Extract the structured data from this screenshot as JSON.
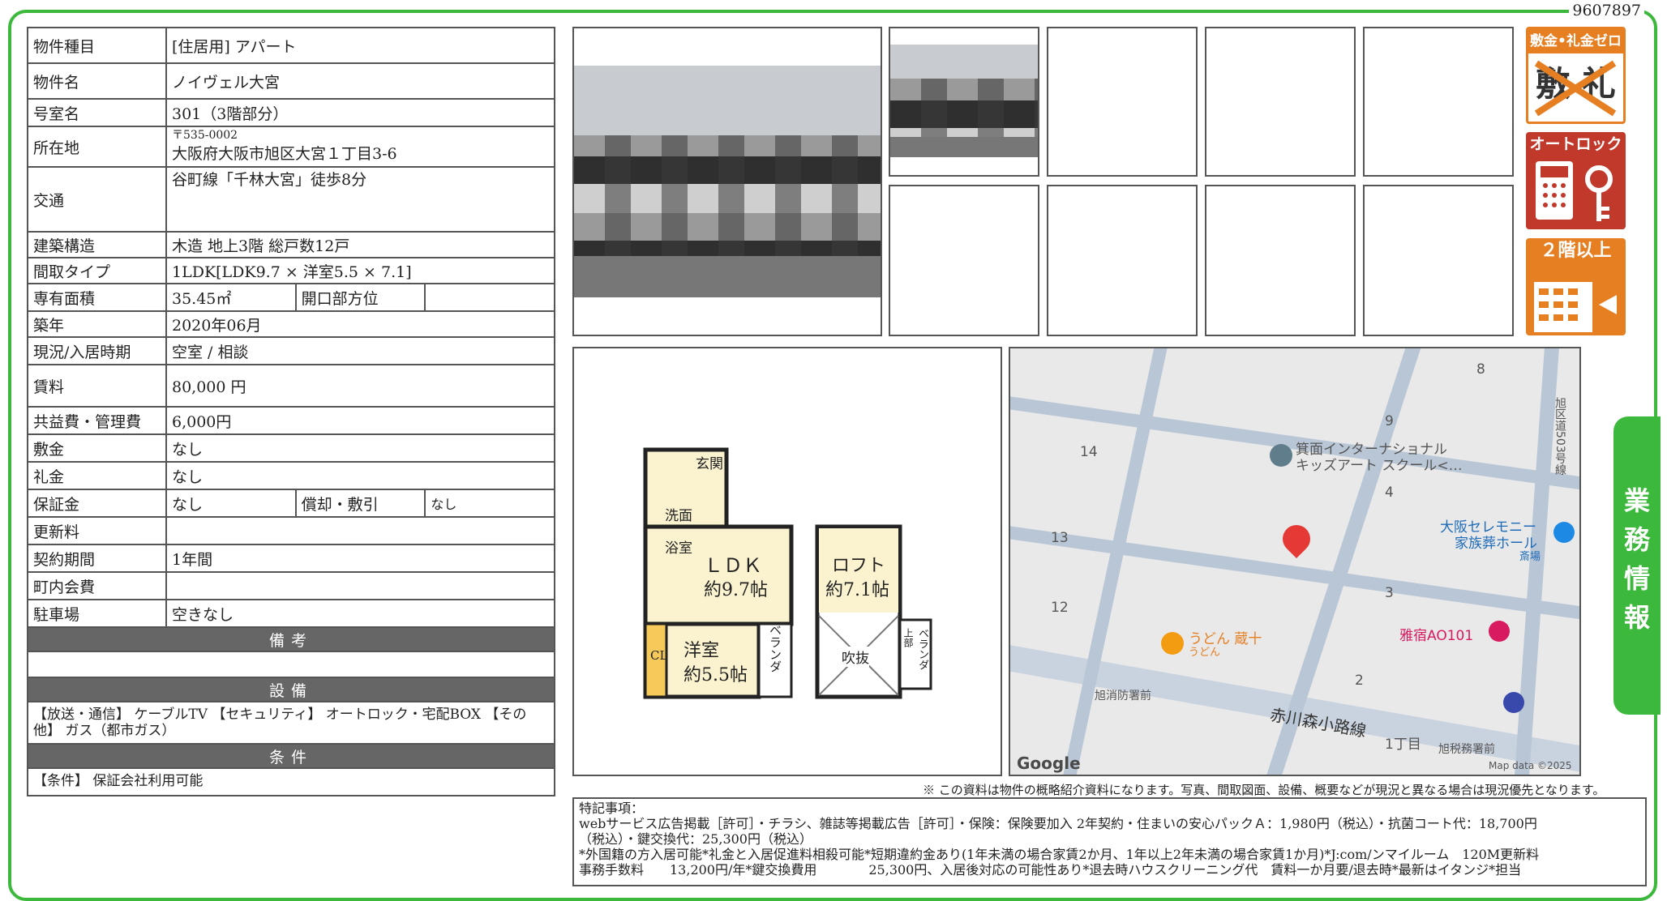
{
  "doc_id": "9607897",
  "property": {
    "rows": {
      "type": {
        "label": "物件種目",
        "value": "[住居用]  アパート"
      },
      "name": {
        "label": "物件名",
        "value": "ノイヴェル大宮"
      },
      "room": {
        "label": "号室名",
        "value": "301（3階部分）"
      },
      "address": {
        "label": "所在地",
        "postal": "〒535-0002",
        "value": "大阪府大阪市旭区大宮１丁目3-6"
      },
      "access": {
        "label": "交通",
        "value": "谷町線「千林大宮」徒歩8分"
      },
      "structure": {
        "label": "建築構造",
        "value": "木造 地上3階 総戸数12戸"
      },
      "layout": {
        "label": "間取タイプ",
        "value": "1LDK[LDK9.7 × 洋室5.5 × 7.1]"
      },
      "area": {
        "label": "専有面積",
        "value": "35.45㎡",
        "label2": "開口部方位",
        "value2": ""
      },
      "built": {
        "label": "築年",
        "value": "2020年06月"
      },
      "status": {
        "label": "現況/入居時期",
        "value": "空室 / 相談"
      },
      "rent": {
        "label": "賃料",
        "value": "80,000 円"
      },
      "fee": {
        "label": "共益費・管理費",
        "value": "6,000円"
      },
      "deposit": {
        "label": "敷金",
        "value": "なし"
      },
      "key_money": {
        "label": "礼金",
        "value": "なし"
      },
      "guarantee": {
        "label": "保証金",
        "value": "なし",
        "label2": "償却・敷引",
        "value2": "なし"
      },
      "renewal": {
        "label": "更新料",
        "value": ""
      },
      "contract": {
        "label": "契約期間",
        "value": "1年間"
      },
      "community": {
        "label": "町内会費",
        "value": ""
      },
      "parking": {
        "label": "駐車場",
        "value": "空きなし"
      }
    },
    "remarks_title": "備考",
    "remarks": "",
    "equipment_title": "設備",
    "equipment": "【放送・通信】 ケーブルTV 【セキュリティ】 オートロック・宅配BOX 【その他】 ガス（都市ガス）",
    "conditions_title": "条件",
    "conditions": "【条件】 保証会社利用可能"
  },
  "badges": {
    "zero": {
      "title": "敷金•礼金ゼロ",
      "body": "敷 礼"
    },
    "autolock": {
      "title": "オートロック"
    },
    "floor": {
      "title": "２階以上"
    }
  },
  "floorplan": {
    "entrance": "玄関",
    "wash": "洗面",
    "bath": "浴室",
    "ldk": "ＬＤＫ",
    "ldk_size": "約9.7帖",
    "western": "洋室",
    "western_size": "約5.5帖",
    "cl": "CL",
    "veranda": "ベランダ",
    "loft": "ロフト",
    "loft_size": "約7.1帖",
    "void": "吹抜",
    "upper": "上部"
  },
  "map": {
    "labels": {
      "n8": "8",
      "n9": "9",
      "n14": "14",
      "n4": "4",
      "n13": "13",
      "n3": "3",
      "n12": "12",
      "n2": "2",
      "school": "箕面インターナショナル",
      "school2": "キッズアート スクール<…",
      "hall": "大阪セレモニー",
      "hall2": "家族葬ホール",
      "hall3": "斎場",
      "udon": "うどん 蔵十",
      "udon2": "うどん",
      "hotel": "雅宿AO101",
      "fire": "旭消防署前",
      "road": "赤川森小路線",
      "chome": "1丁目",
      "tax": "旭税務署前",
      "route": "旭区道503号線",
      "google": "Google",
      "mapdata": "Map data ©2025"
    }
  },
  "side_tab": "業務情報",
  "note": "※ この資料は物件の概略紹介資料になります。写真、間取図面、設備、概要などが現況と異なる場合は現況優先となります。",
  "special": {
    "title": "特記事項：",
    "line1": "webサービス広告掲載［許可］・チラシ、雑誌等掲載広告［許可］・保険：保険要加入 2年契約・住まいの安心パックＡ：1,980円（税込）・抗菌コート代：18,700円",
    "line2": "（税込）・鍵交換代：25,300円（税込）",
    "line3": "*外国籍の方入居可能*礼金と入居促進料相殺可能*短期違約金あり(1年未満の場合家賃2か月、1年以上2年未満の場合家賃1か月)*J:com/ンマイルーム　120M更新料",
    "line4": "事務手数料　　13,200円/年*鍵交換費用　　　　25,300円、入居後対応の可能性あり*退去時ハウスクリーニング代　賃料一か月要/退去時*最新はイタンジ*担当"
  },
  "colors": {
    "frame": "#3cb93c",
    "section": "#666666",
    "badge_orange": "#e67e22",
    "badge_red": "#c0392b"
  }
}
